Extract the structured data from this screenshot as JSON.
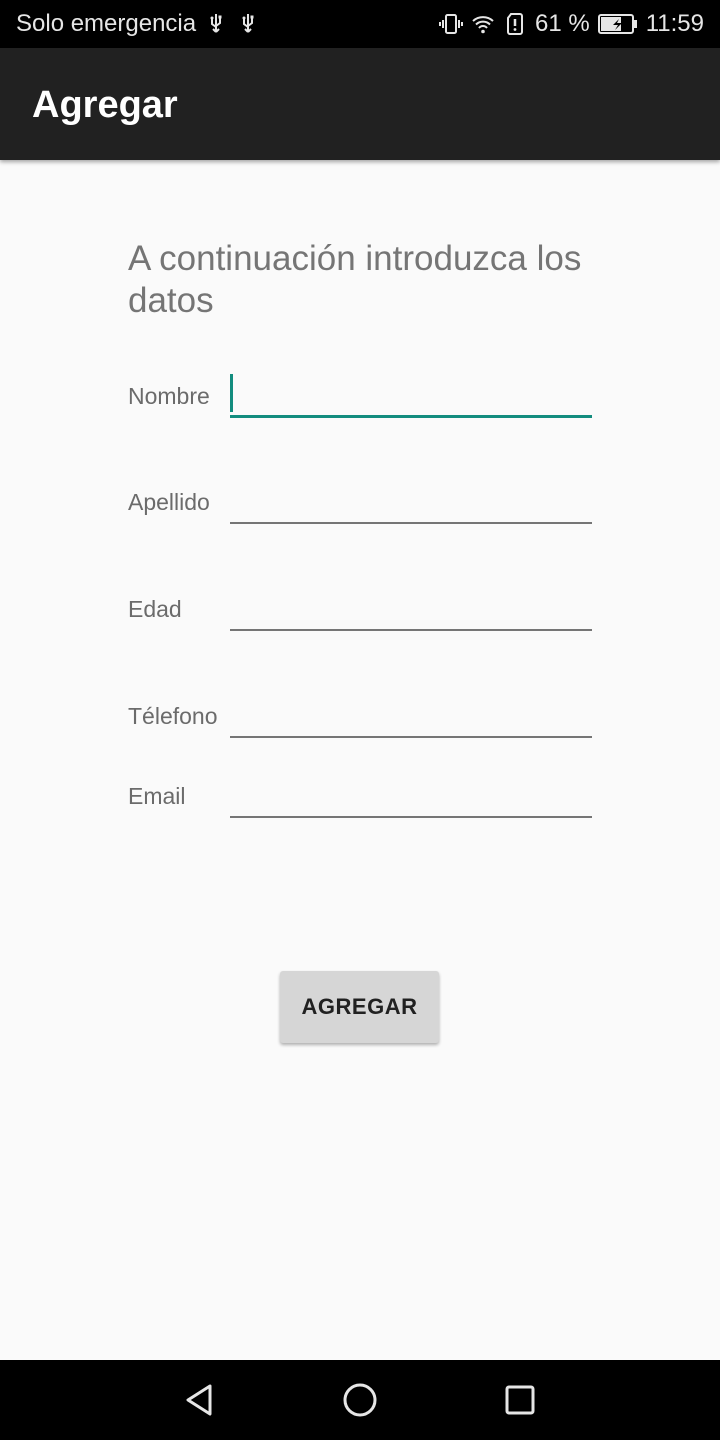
{
  "status_bar": {
    "carrier": "Solo emergencia",
    "battery_percent": "61 %",
    "time": "11:59",
    "icons": [
      "usb-icon",
      "usb-icon",
      "vibrate-icon",
      "wifi-icon",
      "sim-alert-icon",
      "battery-charging-icon"
    ]
  },
  "app_bar": {
    "title": "Agregar"
  },
  "form": {
    "intro": "A continuación introduzca los datos",
    "fields": [
      {
        "label": "Nombre",
        "value": "",
        "focused": true
      },
      {
        "label": "Apellido",
        "value": ""
      },
      {
        "label": "Edad",
        "value": ""
      },
      {
        "label": "Télefono",
        "value": ""
      },
      {
        "label": "Email",
        "value": ""
      }
    ],
    "submit_label": "AGREGAR"
  },
  "nav_bar": {
    "icons": [
      "back-icon",
      "home-icon",
      "recents-icon"
    ]
  },
  "colors": {
    "accent": "#128c7e",
    "app_bar": "#212121",
    "background": "#fafafa"
  }
}
